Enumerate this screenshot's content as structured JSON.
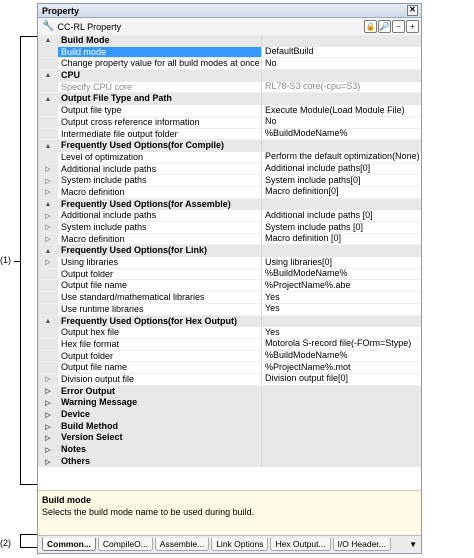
{
  "callouts": {
    "one": "(1)",
    "two": "(2)"
  },
  "panel": {
    "title": "Property",
    "close_glyph": "✕",
    "toolbar": {
      "wrench_glyph": "🔧",
      "label": "CC-RL Property",
      "lock_glyph": "🔒",
      "search_glyph": "🔎",
      "collapse_glyph": "−",
      "expand_glyph": "+"
    }
  },
  "rows": [
    {
      "kind": "cat",
      "toggle": "▲",
      "label": "Build Mode"
    },
    {
      "kind": "prop",
      "label": "Build mode",
      "value": "DefaultBuild",
      "selected": true
    },
    {
      "kind": "prop",
      "label": "Change property value for all build modes at once",
      "value": "No"
    },
    {
      "kind": "cat",
      "toggle": "▲",
      "label": "CPU"
    },
    {
      "kind": "prop",
      "label": "Specify CPU core",
      "value": "RL78-S3 core(-cpu=S3)",
      "gray": true
    },
    {
      "kind": "cat",
      "toggle": "▲",
      "label": "Output File Type and Path"
    },
    {
      "kind": "prop",
      "label": "Output file type",
      "value": "Execute Module(Load Module File)"
    },
    {
      "kind": "prop",
      "label": "Output cross reference information",
      "value": "No"
    },
    {
      "kind": "prop",
      "label": "Intermediate file output folder",
      "value": "%BuildModeName%"
    },
    {
      "kind": "cat",
      "toggle": "▲",
      "label": "Frequently Used Options(for Compile)"
    },
    {
      "kind": "prop",
      "label": "Level of optimization",
      "value": "Perform the default optimization(None)"
    },
    {
      "kind": "prop",
      "toggle": "▷",
      "label": "Additional include paths",
      "value": "Additional include paths[0]"
    },
    {
      "kind": "prop",
      "toggle": "▷",
      "label": "System include paths",
      "value": "System include paths[0]"
    },
    {
      "kind": "prop",
      "toggle": "▷",
      "label": "Macro definition",
      "value": "Macro definition[0]"
    },
    {
      "kind": "cat",
      "toggle": "▲",
      "label": "Frequently Used Options(for Assemble)"
    },
    {
      "kind": "prop",
      "toggle": "▷",
      "label": "Additional include paths",
      "value": "Additional include paths [0]"
    },
    {
      "kind": "prop",
      "toggle": "▷",
      "label": "System include paths",
      "value": "System include paths [0]"
    },
    {
      "kind": "prop",
      "toggle": "▷",
      "label": "Macro definition",
      "value": "Macro definition [0]"
    },
    {
      "kind": "cat",
      "toggle": "▲",
      "label": "Frequently Used Options(for Link)"
    },
    {
      "kind": "prop",
      "toggle": "▷",
      "label": "Using libraries",
      "value": "Using libraries[0]"
    },
    {
      "kind": "prop",
      "label": "Output folder",
      "value": "%BuildModeName%"
    },
    {
      "kind": "prop",
      "label": "Output file name",
      "value": "%ProjectName%.abe"
    },
    {
      "kind": "prop",
      "label": "Use standard/mathematical libraries",
      "value": "Yes"
    },
    {
      "kind": "prop",
      "label": "Use runtime libraries",
      "value": "Yes"
    },
    {
      "kind": "cat",
      "toggle": "▲",
      "label": "Frequently Used Options(for Hex Output)"
    },
    {
      "kind": "prop",
      "label": "Output hex file",
      "value": "Yes"
    },
    {
      "kind": "prop",
      "label": "Hex file format",
      "value": "Motorola S-record file(-FOrm=Stype)"
    },
    {
      "kind": "prop",
      "label": "Output folder",
      "value": "%BuildModeName%"
    },
    {
      "kind": "prop",
      "label": "Output file name",
      "value": "%ProjectName%.mot"
    },
    {
      "kind": "prop",
      "toggle": "▷",
      "label": "Division output file",
      "value": "Division output file[0]"
    },
    {
      "kind": "cat",
      "toggle": "▷",
      "label": "Error Output"
    },
    {
      "kind": "cat",
      "toggle": "▷",
      "label": "Warning Message"
    },
    {
      "kind": "cat",
      "toggle": "▷",
      "label": "Device"
    },
    {
      "kind": "cat",
      "toggle": "▷",
      "label": "Build Method"
    },
    {
      "kind": "cat",
      "toggle": "▷",
      "label": "Version Select"
    },
    {
      "kind": "cat",
      "toggle": "▷",
      "label": "Notes"
    },
    {
      "kind": "cat",
      "toggle": "▷",
      "label": "Others"
    }
  ],
  "description": {
    "title": "Build mode",
    "text": "Selects the build mode name to be used during build."
  },
  "tabs": {
    "items": [
      "Common...",
      "CompileO...",
      "Assemble...",
      "Link Options",
      "Hex Output...",
      "I/O Header..."
    ],
    "active_index": 0,
    "more_glyph": "▼"
  }
}
